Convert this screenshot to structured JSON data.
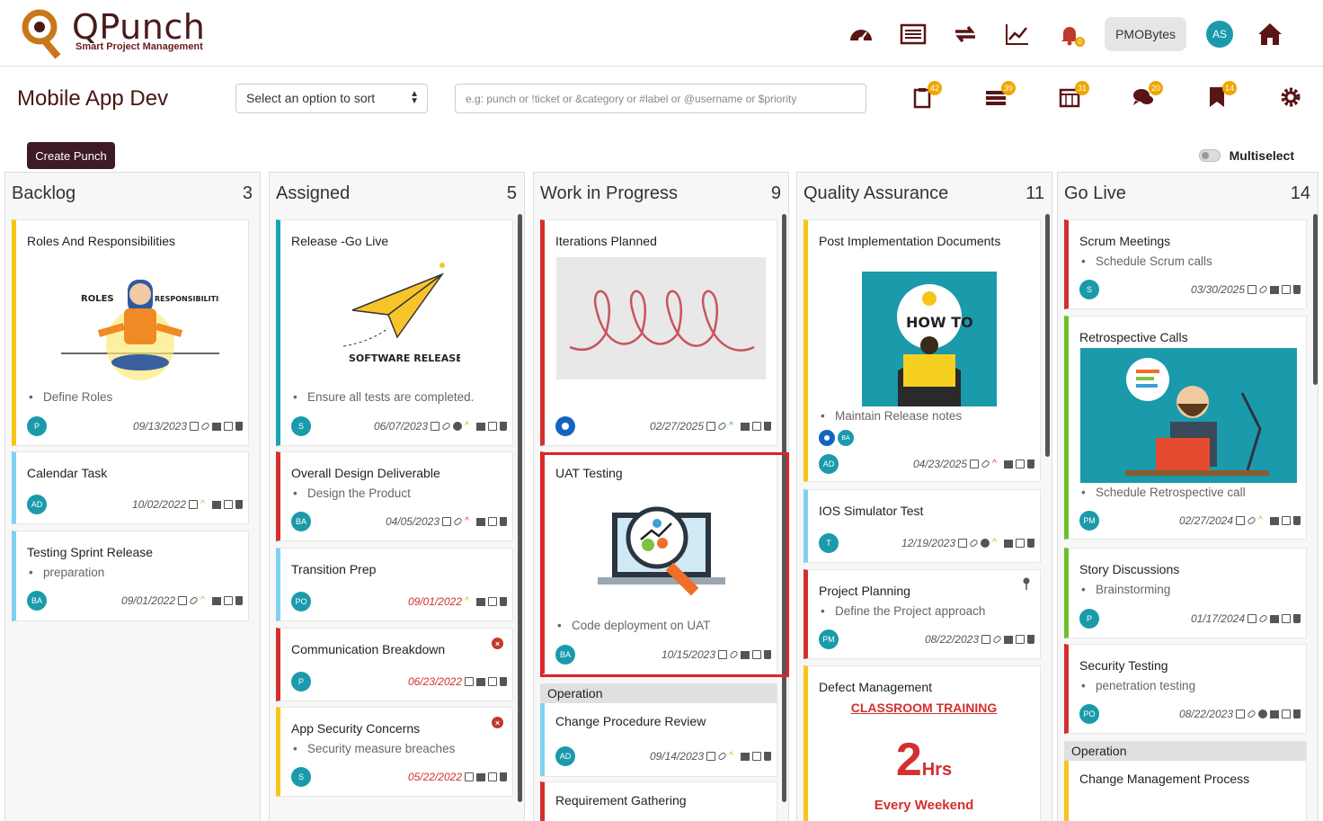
{
  "app": {
    "logo_text": "QPunch",
    "logo_sub": "Smart Project Management"
  },
  "topbar": {
    "user_button": "PMOBytes",
    "avatar": "AS",
    "notif_count": "0"
  },
  "toolbar": {
    "title": "Mobile App Dev",
    "sort_label": "Select an option to sort",
    "search_placeholder": "e.g: punch or !ticket or &category or #label or @username or $priority",
    "badges": [
      "42",
      "39",
      "31",
      "20",
      "14"
    ]
  },
  "actions": {
    "create": "Create Punch",
    "multiselect": "Multiselect"
  },
  "columns": [
    {
      "title": "Backlog",
      "count": "3"
    },
    {
      "title": "Assigned",
      "count": "5"
    },
    {
      "title": "Work in Progress",
      "count": "9"
    },
    {
      "title": "Quality Assurance",
      "count": "11"
    },
    {
      "title": "Go Live",
      "count": "14"
    }
  ],
  "cards": {
    "c0_0": {
      "title": "Roles And Responsibilities",
      "bullet": "Define Roles",
      "av": "P",
      "date": "09/13/2023",
      "img1": "ROLES",
      "img2": "RESPONSIBILITIES"
    },
    "c0_1": {
      "title": "Calendar Task",
      "av": "AD",
      "date": "10/02/2022"
    },
    "c0_2": {
      "title": "Testing Sprint Release",
      "bullet": "preparation",
      "av": "BA",
      "date": "09/01/2022"
    },
    "c1_0": {
      "title": "Release -Go Live",
      "bullet": "Ensure all tests are completed.",
      "av": "S",
      "date": "06/07/2023",
      "img": "SOFTWARE RELEASE"
    },
    "c1_1": {
      "title": "Overall Design Deliverable",
      "bullet": "Design the Product",
      "av": "BA",
      "date": "04/05/2023"
    },
    "c1_2": {
      "title": "Transition Prep",
      "av": "PO",
      "date": "09/01/2022"
    },
    "c1_3": {
      "title": "Communication Breakdown",
      "av": "P",
      "date": "06/23/2022"
    },
    "c1_4": {
      "title": "App Security Concerns",
      "bullet": "Security measure breaches",
      "av": "S",
      "date": "05/22/2022"
    },
    "c2_0": {
      "title": "Iterations Planned",
      "date": "02/27/2025"
    },
    "c2_1": {
      "title": "UAT Testing",
      "bullet": "Code deployment on UAT",
      "av": "BA",
      "date": "10/15/2023"
    },
    "c2_2": {
      "label": "Operation",
      "title": "Change Procedure Review",
      "av": "AD",
      "date": "09/14/2023"
    },
    "c2_3": {
      "title": "Requirement Gathering"
    },
    "c3_0": {
      "title": "Post Implementation Documents",
      "bullet": "Maintain Release notes",
      "av2": "BA",
      "av": "AD",
      "date": "04/23/2025",
      "img": "HOW TO"
    },
    "c3_1": {
      "title": "IOS Simulator Test",
      "av": "T",
      "date": "12/19/2023"
    },
    "c3_2": {
      "title": "Project Planning",
      "bullet": "Define the Project approach",
      "av": "PM",
      "date": "08/22/2023"
    },
    "c3_3": {
      "title": "Defect Management",
      "link": "CLASSROOM TRAINING",
      "big": "2",
      "unit": "Hrs",
      "sub": "Every Weekend"
    },
    "c4_0": {
      "title": "Scrum Meetings",
      "bullet": "Schedule Scrum calls",
      "av": "S",
      "date": "03/30/2025"
    },
    "c4_1": {
      "title": "Retrospective Calls",
      "bullet": "Schedule Retrospective call",
      "av": "PM",
      "date": "02/27/2024"
    },
    "c4_2": {
      "title": "Story Discussions",
      "bullet": "Brainstorming",
      "av": "P",
      "date": "01/17/2024"
    },
    "c4_3": {
      "title": "Security Testing",
      "bullet": "penetration testing",
      "av": "PO",
      "date": "08/22/2023"
    },
    "c4_4": {
      "label": "Operation",
      "title": "Change Management Process"
    }
  }
}
